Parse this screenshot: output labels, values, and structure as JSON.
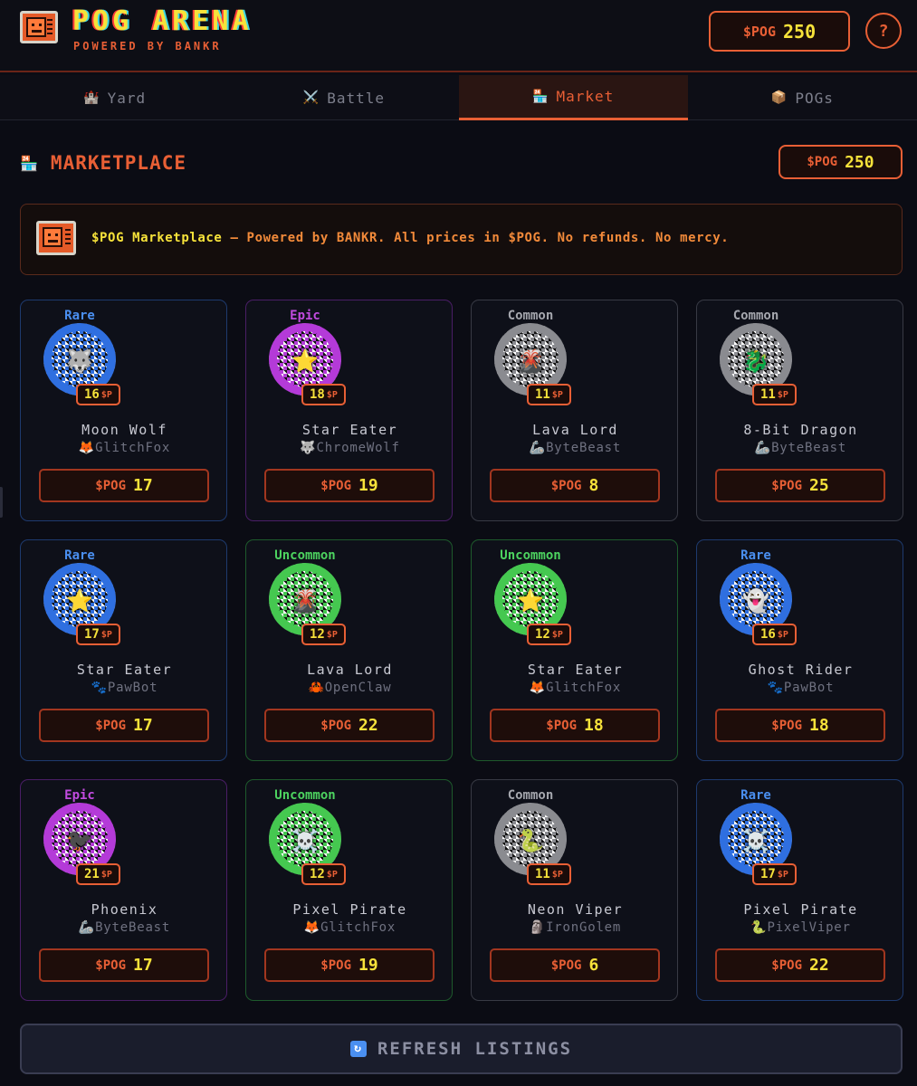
{
  "app": {
    "title": "POG ARENA",
    "subtitle": "POWERED BY BANKR",
    "logo_icon": "retro-computer-icon",
    "currency": "$POG",
    "balance": "250",
    "help_label": "?"
  },
  "tabs": [
    {
      "label": "Yard",
      "icon": "🏰",
      "active": false
    },
    {
      "label": "Battle",
      "icon": "⚔️",
      "active": false
    },
    {
      "label": "Market",
      "icon": "🏪",
      "active": true
    },
    {
      "label": "POGs",
      "icon": "📦",
      "active": false
    }
  ],
  "section": {
    "icon": "🏪",
    "title": "MARKETPLACE",
    "currency": "$POG",
    "balance": "250"
  },
  "banner": {
    "brand": "$POG Marketplace",
    "text": " — Powered by BANKR. All prices in $POG. No refunds. No mercy."
  },
  "price_unit": "$P",
  "buy_currency": "$POG",
  "listings": [
    {
      "rarity": "Rare",
      "tier": "rare",
      "emoji": "🐺",
      "value": "16",
      "name": "Moon Wolf",
      "seller": "🦊GlitchFox",
      "price": "17"
    },
    {
      "rarity": "Epic",
      "tier": "epic",
      "emoji": "⭐",
      "value": "18",
      "name": "Star Eater",
      "seller": "🐺ChromeWolf",
      "price": "19"
    },
    {
      "rarity": "Common",
      "tier": "common",
      "emoji": "🌋",
      "value": "11",
      "name": "Lava Lord",
      "seller": "🦾ByteBeast",
      "price": "8"
    },
    {
      "rarity": "Common",
      "tier": "common",
      "emoji": "🐉",
      "value": "11",
      "name": "8-Bit Dragon",
      "seller": "🦾ByteBeast",
      "price": "25"
    },
    {
      "rarity": "Rare",
      "tier": "rare",
      "emoji": "⭐",
      "value": "17",
      "name": "Star Eater",
      "seller": "🐾PawBot",
      "price": "17"
    },
    {
      "rarity": "Uncommon",
      "tier": "uncommon",
      "emoji": "🌋",
      "value": "12",
      "name": "Lava Lord",
      "seller": "🦀OpenClaw",
      "price": "22"
    },
    {
      "rarity": "Uncommon",
      "tier": "uncommon",
      "emoji": "⭐",
      "value": "12",
      "name": "Star Eater",
      "seller": "🦊GlitchFox",
      "price": "18"
    },
    {
      "rarity": "Rare",
      "tier": "rare",
      "emoji": "👻",
      "value": "16",
      "name": "Ghost Rider",
      "seller": "🐾PawBot",
      "price": "18"
    },
    {
      "rarity": "Epic",
      "tier": "epic",
      "emoji": "🐦‍⬛",
      "value": "21",
      "name": "Phoenix",
      "seller": "🦾ByteBeast",
      "price": "17"
    },
    {
      "rarity": "Uncommon",
      "tier": "uncommon",
      "emoji": "☠️",
      "value": "12",
      "name": "Pixel Pirate",
      "seller": "🦊GlitchFox",
      "price": "19"
    },
    {
      "rarity": "Common",
      "tier": "common",
      "emoji": "🐍",
      "value": "11",
      "name": "Neon Viper",
      "seller": "🗿IronGolem",
      "price": "6"
    },
    {
      "rarity": "Rare",
      "tier": "rare",
      "emoji": "☠️",
      "value": "17",
      "name": "Pixel Pirate",
      "seller": "🐍PixelViper",
      "price": "22"
    }
  ],
  "refresh": {
    "label": "REFRESH LISTINGS",
    "icon": "🔄"
  },
  "colors": {
    "accent": "#e85f35",
    "gold": "#f7e23a",
    "rare": "#4a8ff0",
    "epic": "#c24be0",
    "uncommon": "#4dd460",
    "common": "#a5a7ae",
    "background": "#0b0c14"
  }
}
